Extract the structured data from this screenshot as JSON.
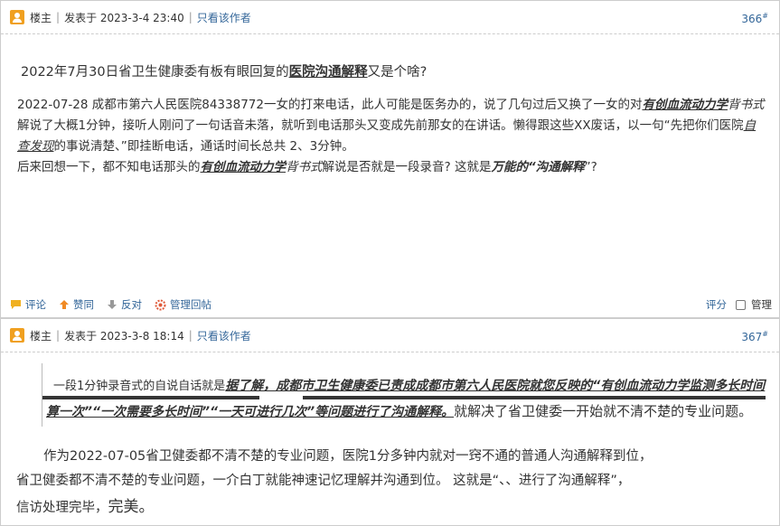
{
  "posts": [
    {
      "author_role": "楼主",
      "posted_label": "发表于 2023-3-4 23:40",
      "only_author": "只看该作者",
      "floor": "366",
      "floor_mark": "#",
      "headline_pre": "2022年7月30日省卫生健康委有板有眼回复的",
      "headline_hl": "医院沟通解释",
      "headline_post": "又是个啥?",
      "p1_a": "2022-07-28 成都市第六人民医院84338772一女的打来电话，此人可能是医务办的，说了几句过后又换了一女的对",
      "p1_b": "有创血流动力学",
      "p1_c": "背书式",
      "p1_d": "解说了大概1分钟，接听人刚问了一句话音未落，就听到电话那头又变成先前那女的在讲话。懒得跟这些XX废话，以一句“先把你们医院",
      "p1_e": "自查发现",
      "p1_f": "的事说清楚、”即挂断电话，通话时间长总共 2、3分钟。",
      "p2_a": "后来回想一下，都不知电话那头的",
      "p2_b": "有创血流动力学",
      "p2_c": "背书式",
      "p2_d": "解说是否就是一段录音? 这就是",
      "p2_e": "万能的“沟通解释",
      "p2_f": "”?"
    },
    {
      "author_role": "楼主",
      "posted_label": "发表于 2023-3-8 18:14",
      "only_author": "只看该作者",
      "floor": "367",
      "floor_mark": "#",
      "quote_a": "一段1分钟录音式的自说自话就是",
      "quote_b": "据了解，成都市卫生健康委已责成成都市第六人民医院就您反映的“有创血流动力学监测多长时间",
      "quote_c": "算一次”“一次需要多长时间”“一天可进行几次”等问题进行了沟通解释。",
      "quote_d": "就解决了省卫健委一开始就不清不楚的专业问题。",
      "line1": "作为2022-07-05省卫健委都不清不楚的专业问题，医院1分多钟内就对一窍不通的普通人沟通解释到位，",
      "line2": "省卫健委都不清不楚的专业问题，一介白丁就能神速记忆理解并沟通到位。 这就是“、、进行了沟通解释”，",
      "line3_a": "信访处理完毕，",
      "line3_b": "完美。"
    }
  ],
  "actions": {
    "comment": "评论",
    "upvote": "赞同",
    "downvote": "反对",
    "manage_reply": "管理回帖",
    "rate": "评分",
    "manage": "管理"
  },
  "colors": {
    "link": "#336699",
    "author_icon": "#f0a020",
    "upvote": "#f08a24",
    "downvote": "#999999",
    "manage_reply": "#e05a3a"
  }
}
